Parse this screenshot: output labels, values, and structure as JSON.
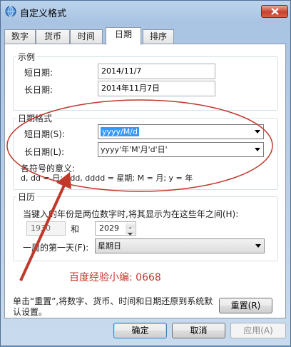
{
  "window": {
    "title": "自定义格式"
  },
  "tabs": [
    {
      "label": "数字"
    },
    {
      "label": "货币"
    },
    {
      "label": "时间"
    },
    {
      "label": "日期"
    },
    {
      "label": "排序"
    }
  ],
  "examples": {
    "heading": "示例",
    "short_label": "短日期:",
    "short_value": "2014/11/7",
    "long_label": "长日期:",
    "long_value": "2014年11月7日"
  },
  "formats": {
    "heading": "日期格式",
    "short_label": "短日期(S):",
    "short_value": "yyyy/M/d",
    "long_label": "长日期(L):",
    "long_value": "yyyy'年'M'月'd'日'",
    "legend_heading": "各符号的意义:",
    "legend_text": "d, dd = 日;   ddd, dddd = 星期;   M = 月;   y = 年"
  },
  "calendar": {
    "heading": "日历",
    "two_digit_label": "当键入的年份是两位数字时,将其显示为在这些年之间(H):",
    "year_from": "1930",
    "and_label": "和",
    "year_to": "2029",
    "first_day_label": "一周的第一天(F):",
    "first_day_value": "星期日"
  },
  "watermark": {
    "caption": "百度经验小编: 0668"
  },
  "footer": {
    "reset_text": "单击“重置”,将数字、货币、时间和日期还原到系统默认设置。",
    "reset_button": "重置(R)"
  },
  "buttons": {
    "ok": "确定",
    "cancel": "取消",
    "apply": "应用(A)"
  },
  "colors": {
    "accent_selection": "#3399ff",
    "annotation_red": "#c0392b"
  },
  "icons": {
    "title": "globe-clock-icon",
    "close": "close-icon"
  }
}
